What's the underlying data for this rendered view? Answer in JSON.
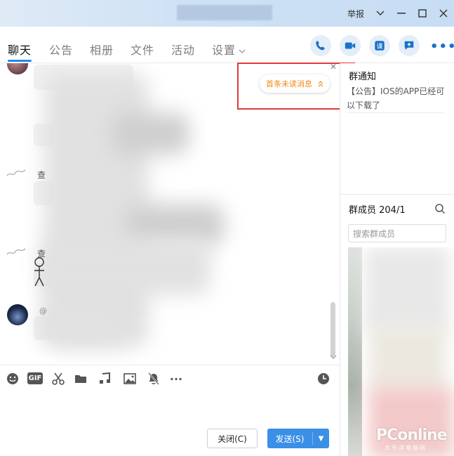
{
  "titlebar": {
    "report_label": "举报"
  },
  "tabs": [
    {
      "label": "聊天"
    },
    {
      "label": "公告"
    },
    {
      "label": "相册"
    },
    {
      "label": "文件"
    },
    {
      "label": "活动"
    },
    {
      "label": "设置"
    }
  ],
  "chat": {
    "unread_label": "首条未读消息",
    "fragment_1": "查",
    "fragment_2": "查"
  },
  "composer": {
    "close_label": "关闭(C)",
    "send_label": "发送(S)"
  },
  "notice": {
    "title": "群通知",
    "body": "【公告】IOS的APP已经可以下载了"
  },
  "members": {
    "title": "群成员 204/1",
    "search_placeholder": "搜索群成员"
  },
  "watermark": {
    "brand": "PConline",
    "sub": "太平洋电脑网"
  },
  "colors": {
    "accent": "#1e8cee",
    "unread": "#f08a1c",
    "highlight": "#e03a3a"
  }
}
